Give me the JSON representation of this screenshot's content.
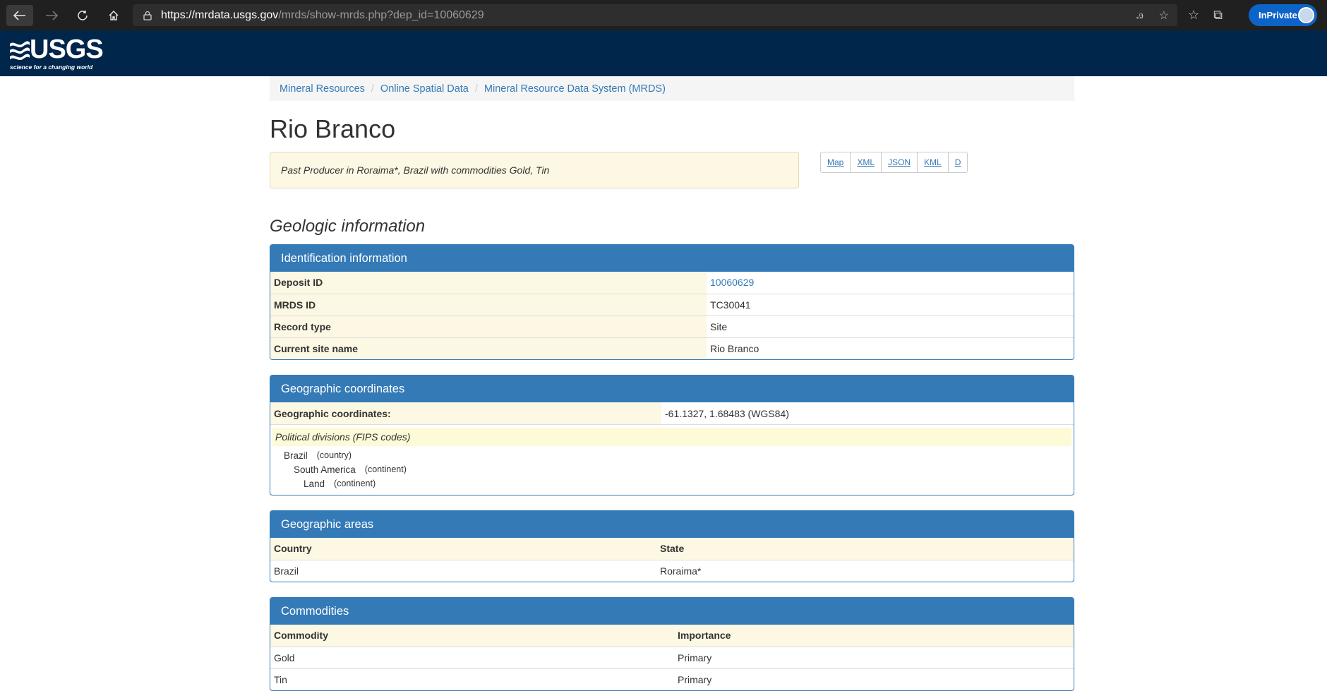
{
  "browser": {
    "url_host": "https://mrdata.usgs.gov",
    "url_path": "/mrds/show-mrds.php?dep_id=10060629",
    "inprivate_label": "InPrivate"
  },
  "header": {
    "logo_text": "USGS",
    "logo_tagline": "science for a changing world"
  },
  "breadcrumb": [
    "Mineral Resources",
    "Online Spatial Data",
    "Mineral Resource Data System (MRDS)"
  ],
  "page": {
    "title": "Rio Branco",
    "summary": "Past Producer in Roraima*, Brazil with commodities Gold, Tin",
    "format_buttons": [
      "Map",
      "XML",
      "JSON",
      "KML",
      "D"
    ],
    "section_title": "Geologic information"
  },
  "identification": {
    "heading": "Identification information",
    "rows": [
      {
        "label": "Deposit ID",
        "value": "10060629"
      },
      {
        "label": "MRDS ID",
        "value": "TC30041"
      },
      {
        "label": "Record type",
        "value": "Site"
      },
      {
        "label": "Current site name",
        "value": "Rio Branco"
      }
    ]
  },
  "coordinates": {
    "heading": "Geographic coordinates",
    "label": "Geographic coordinates:",
    "value": "-61.1327, 1.68483 (WGS84)",
    "political_title": "Political divisions (FIPS codes)",
    "divisions": [
      {
        "name": "Brazil",
        "kind": "(country)"
      },
      {
        "name": "South America",
        "kind": "(continent)"
      },
      {
        "name": "Land",
        "kind": "(continent)"
      }
    ]
  },
  "areas": {
    "heading": "Geographic areas",
    "columns": [
      "Country",
      "State"
    ],
    "rows": [
      [
        "Brazil",
        "Roraima*"
      ]
    ]
  },
  "commodities": {
    "heading": "Commodities",
    "columns": [
      "Commodity",
      "Importance"
    ],
    "rows": [
      [
        "Gold",
        "Primary"
      ],
      [
        "Tin",
        "Primary"
      ]
    ]
  }
}
